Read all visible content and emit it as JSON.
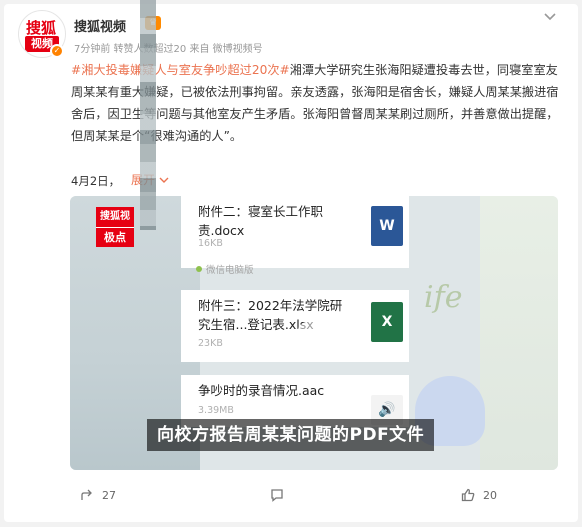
{
  "post": {
    "author": "搜狐视频",
    "avatar_top": "搜狐",
    "avatar_bottom": "视频",
    "meta": "7分钟前 转赞人数超过20  来自 微博视频号",
    "hashtag": "#湘大投毒嫌疑人与室友争吵超过20次#",
    "body": "湘潭大学研究生张海阳疑遭投毒去世，同寝室室友周某某有重大嫌疑，已被依法刑事拘留。亲友透露，张海阳是宿舍长，嫌疑人周某某搬进宿舍后，因卫生等问题与其他室友产生矛盾。张海阳曾督周某某刷过厕所，并善意做出提醒，但周某某是个“很难沟通的人”。",
    "date": "4月2日，",
    "expand_label": "展开"
  },
  "video": {
    "watermark_top": "搜狐视频",
    "watermark_bottom": "极点",
    "files": [
      {
        "name": "附件二：寝室长工作职责.docx",
        "size": "16KB",
        "type": "W"
      },
      {
        "name": "附件三：2022年法学院研究生宿...登记表.xlsx",
        "size": "23KB",
        "type": "X"
      },
      {
        "name": "争吵时的录音情况.aac",
        "size": "3.39MB",
        "type": "audio"
      }
    ],
    "wechat_note": "微信电脑版",
    "subtitle": "向校方报告周某某问题的PDF文件",
    "deco": "ife"
  },
  "actions": {
    "share_count": "27",
    "comment_count": "",
    "like_count": "20"
  },
  "icons": [
    "chevron-down-icon",
    "share-icon",
    "comment-icon",
    "like-icon",
    "play-icon",
    "verified-icon"
  ],
  "colors": {
    "accent": "#eb7350",
    "brand": "#e60012",
    "verified": "#ff8200"
  }
}
